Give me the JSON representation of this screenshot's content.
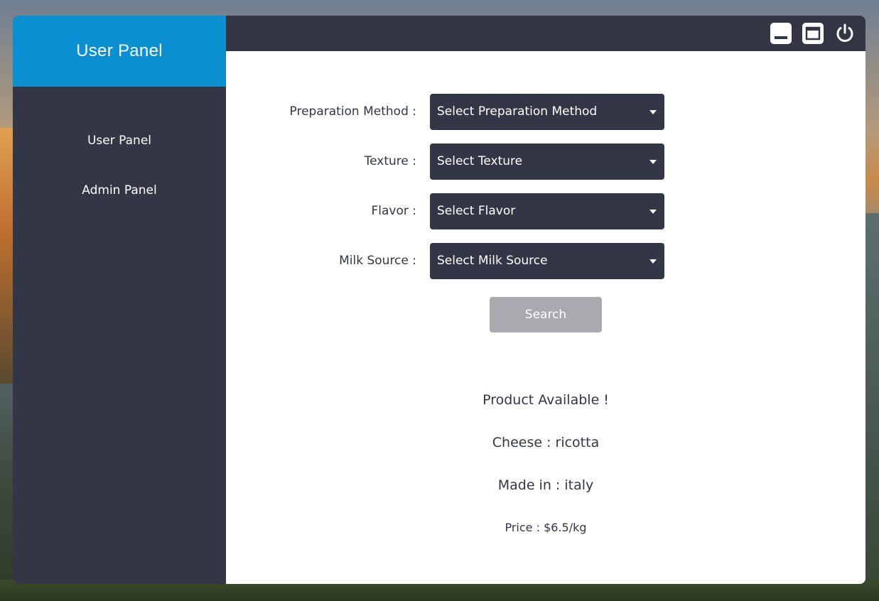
{
  "sidebar": {
    "title": "User Panel",
    "items": [
      {
        "label": "User Panel"
      },
      {
        "label": "Admin Panel"
      }
    ]
  },
  "topbar": {
    "icons": [
      "minimize-icon",
      "maximize-icon",
      "power-icon"
    ]
  },
  "form": {
    "fields": [
      {
        "label": "Preparation Method :",
        "value": "Select Preparation Method"
      },
      {
        "label": "Texture :",
        "value": "Select Texture"
      },
      {
        "label": "Flavor :",
        "value": "Select Flavor"
      },
      {
        "label": "Milk Source :",
        "value": "Select Milk Source"
      }
    ],
    "search_label": "Search"
  },
  "result": {
    "status": "Product Available !",
    "cheese": "Cheese : ricotta",
    "origin": "Made in : italy",
    "price": "Price : $6.5/kg"
  },
  "colors": {
    "sidebar_bg": "#333645",
    "header_accent": "#0a8fd0",
    "button_disabled": "#a9aab0",
    "content_bg": "#ffffff"
  }
}
